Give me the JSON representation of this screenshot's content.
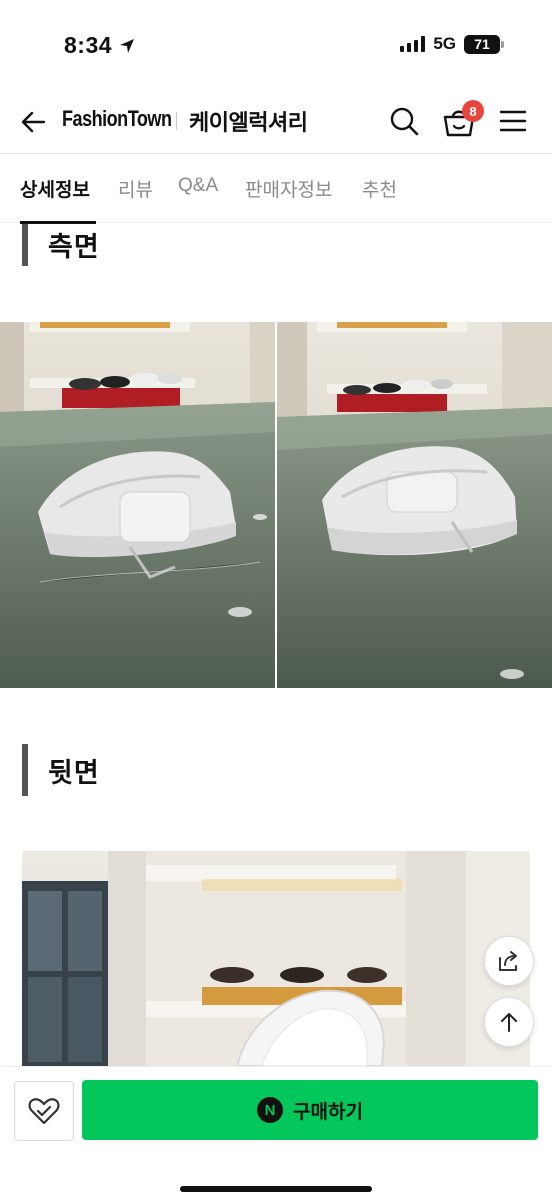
{
  "status_bar": {
    "time": "8:34",
    "network": "5G",
    "battery": "71"
  },
  "header": {
    "brand": "FashionTown",
    "shop_name": "케이엘럭셔리",
    "cart_count": "8"
  },
  "tabs": [
    {
      "label": "상세정보",
      "active": true
    },
    {
      "label": "리뷰",
      "active": false
    },
    {
      "label": "Q&A",
      "active": false
    },
    {
      "label": "판매자정보",
      "active": false
    },
    {
      "label": "추천",
      "active": false
    }
  ],
  "sections": {
    "side": {
      "title": "측면"
    },
    "back": {
      "title": "뒷면"
    }
  },
  "bottom_bar": {
    "npay_mark": "N",
    "buy_label": "구매하기"
  },
  "colors": {
    "buy_green": "#03c75a",
    "badge_red": "#e8453c"
  }
}
